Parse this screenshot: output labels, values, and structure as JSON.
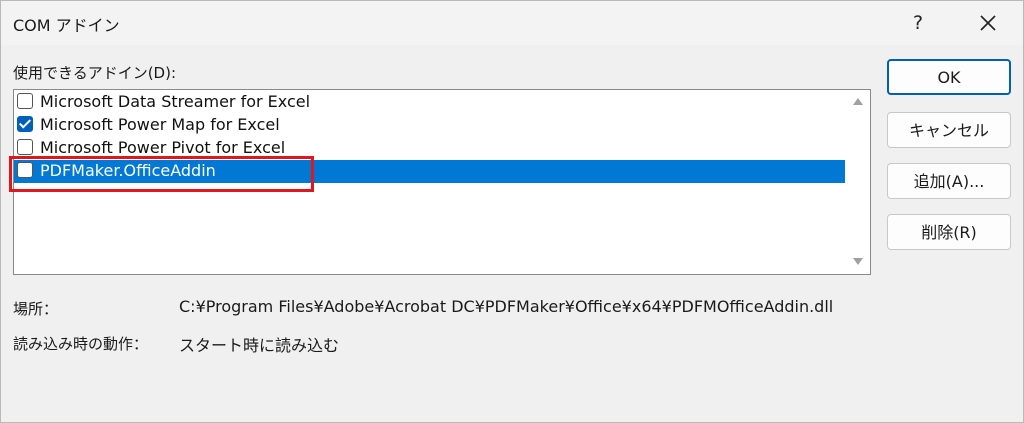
{
  "window": {
    "title": "COM アドイン",
    "help": "?"
  },
  "list": {
    "label": "使用できるアドイン(D):",
    "items": [
      {
        "label": "Microsoft Data Streamer for Excel",
        "checked": false,
        "selected": false
      },
      {
        "label": "Microsoft Power Map for Excel",
        "checked": true,
        "selected": false
      },
      {
        "label": "Microsoft Power Pivot for Excel",
        "checked": false,
        "selected": false
      },
      {
        "label": "PDFMaker.OfficeAddin",
        "checked": false,
        "selected": true
      }
    ]
  },
  "buttons": {
    "ok": "OK",
    "cancel": "キャンセル",
    "add": "追加(A)...",
    "remove": "削除(R)"
  },
  "info": {
    "location_label": "場所：",
    "location_value": "C:¥Program Files¥Adobe¥Acrobat DC¥PDFMaker¥Office¥x64¥PDFMOfficeAddin.dll",
    "load_label": "読み込み時の動作：",
    "load_value": "スタート時に読み込む"
  },
  "colors": {
    "selection": "#0078d4",
    "highlight_box": "#e0181d",
    "checkbox_checked": "#005fb8"
  },
  "icons": {
    "help": "question-mark-icon",
    "close": "close-icon",
    "scroll_up": "scroll-up-icon",
    "scroll_down": "scroll-down-icon",
    "check": "checkmark-icon"
  }
}
